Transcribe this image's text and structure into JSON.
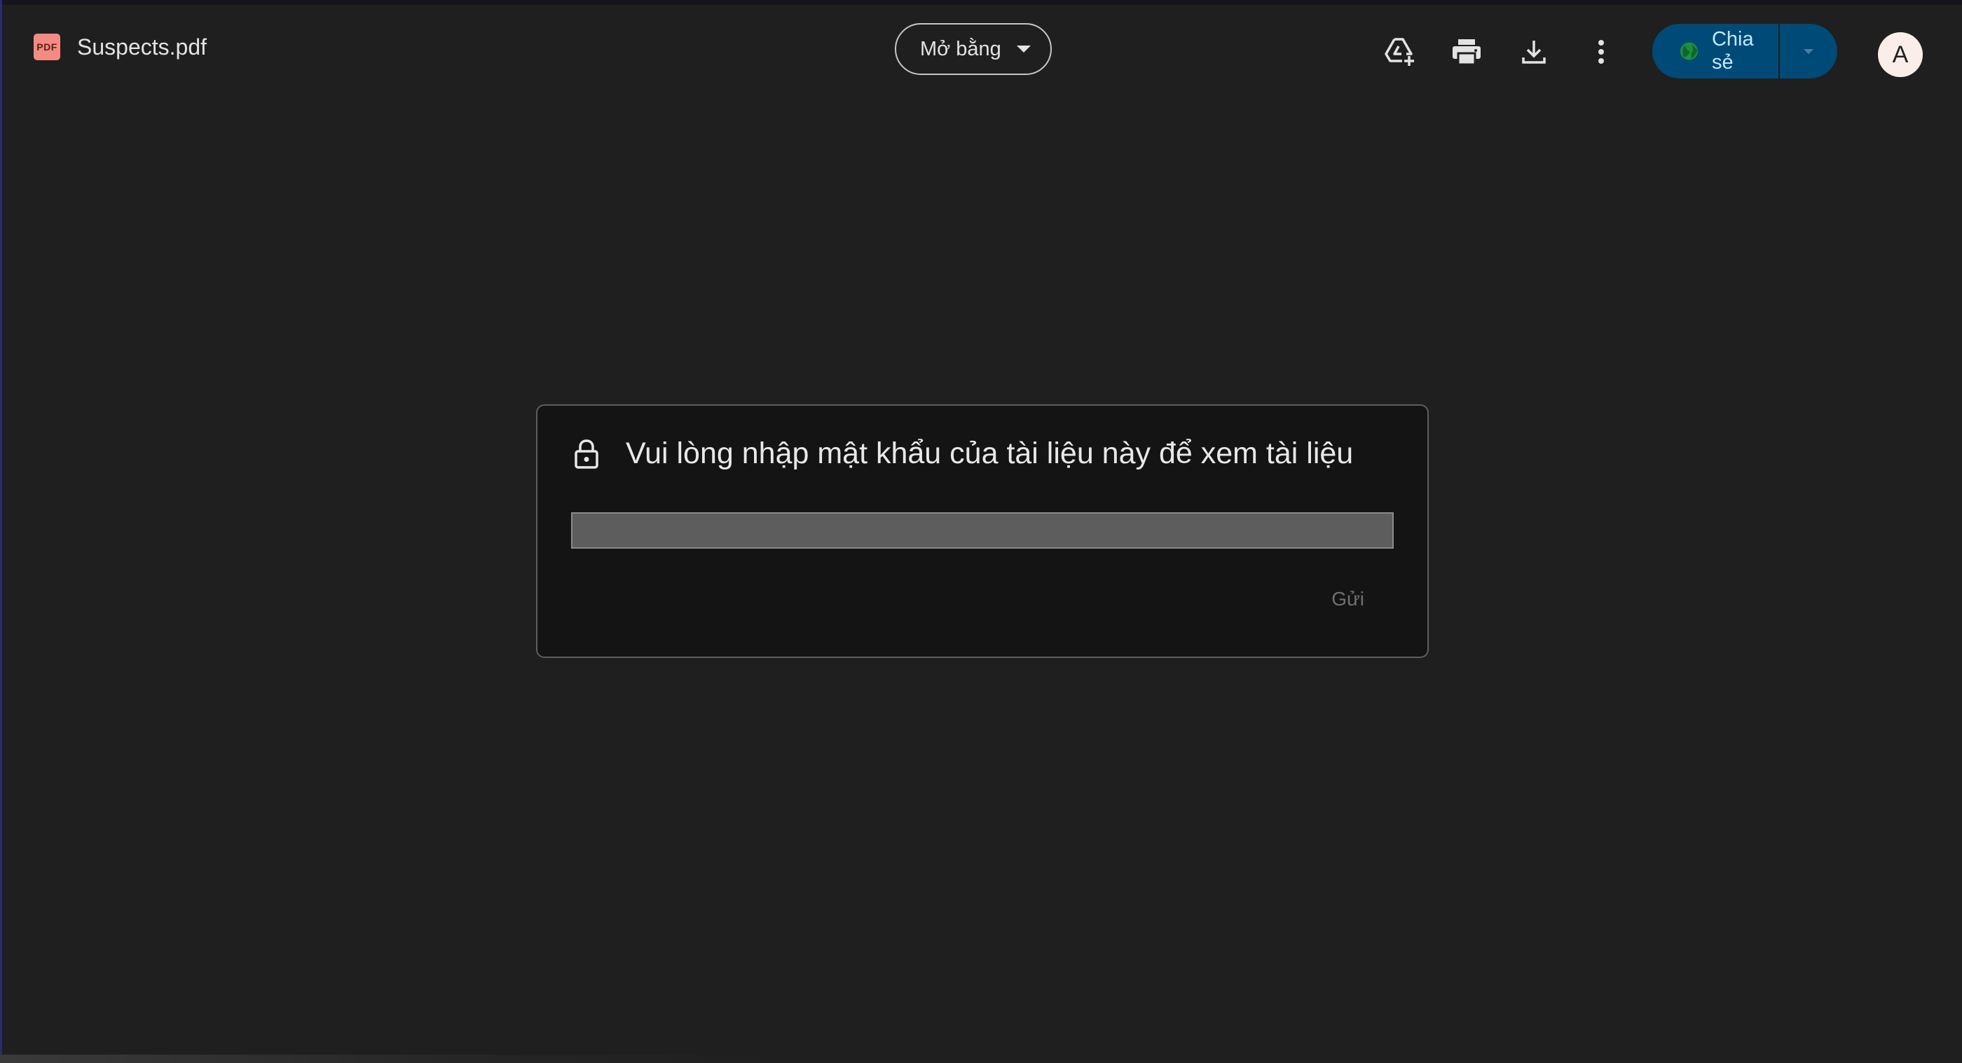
{
  "header": {
    "file_icon_label": "PDF",
    "file_name": "Suspects.pdf",
    "open_with_label": "Mở bằng",
    "toolbar_icons": [
      "add-to-drive-icon",
      "print-icon",
      "download-icon",
      "more-options-icon"
    ],
    "share_label": "Chia sẻ",
    "avatar_letter": "A"
  },
  "dialog": {
    "title": "Vui lòng nhập mật khẩu của tài liệu này để xem tài liệu",
    "password_value": "",
    "submit_label": "Gửi"
  },
  "colors": {
    "background": "#1f1f1f",
    "share_button": "#004a77",
    "share_text": "#c2e7ff",
    "pdf_icon": "#f28b82",
    "avatar": "#fbeee8"
  }
}
